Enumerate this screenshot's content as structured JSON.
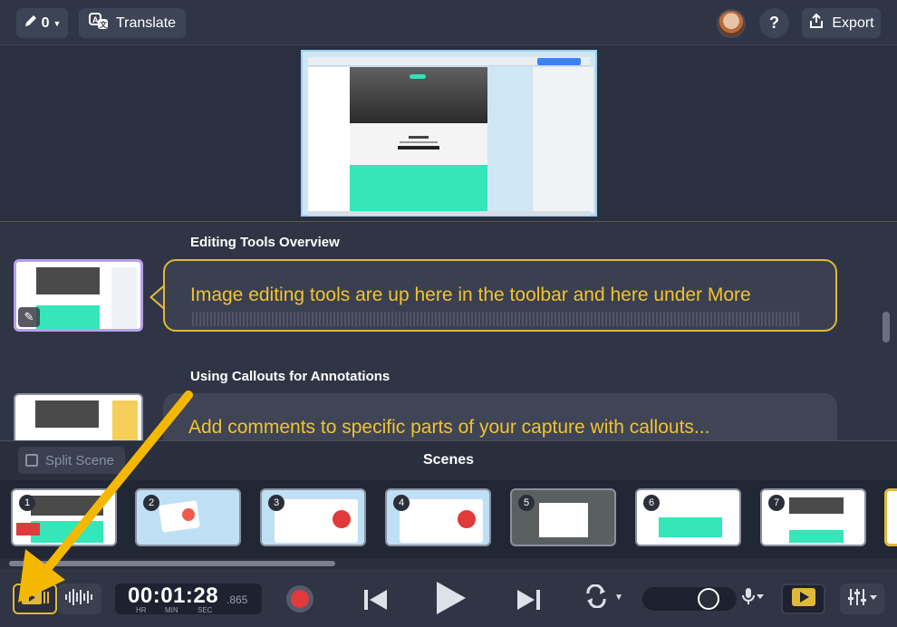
{
  "toolbar": {
    "edit_count": "0",
    "translate_label": "Translate",
    "help_label": "?",
    "export_label": "Export"
  },
  "script": {
    "items": [
      {
        "title": "Editing Tools Overview",
        "text": "Image editing tools are up here in the toolbar and here under More"
      },
      {
        "title": "Using Callouts for Annotations",
        "text": "Add comments to specific parts of your capture with callouts..."
      }
    ]
  },
  "scenes": {
    "title": "Scenes",
    "split_label": "Split Scene",
    "cards": [
      "1",
      "2",
      "3",
      "4",
      "5",
      "6",
      "7"
    ]
  },
  "playback": {
    "timecode": "00:01:28",
    "milliseconds": ".865",
    "label_hr": "HR",
    "label_min": "MIN",
    "label_sec": "SEC",
    "volume_level": 0.78
  },
  "colors": {
    "accent": "#e0b83b",
    "script_text": "#f2c230",
    "record": "#e03a3a",
    "teal": "#34e6b8"
  },
  "icons": {
    "edit": "pencil-icon",
    "translate": "translate-icon",
    "export": "share-icon",
    "video_track": "video-track-icon",
    "audio_track": "waveform-icon",
    "record": "record-icon",
    "previous": "skip-back-icon",
    "play": "play-icon",
    "next": "skip-forward-icon",
    "loop": "loop-icon",
    "mic": "microphone-icon",
    "preview": "preview-play-icon",
    "mixer": "mixer-icon"
  }
}
